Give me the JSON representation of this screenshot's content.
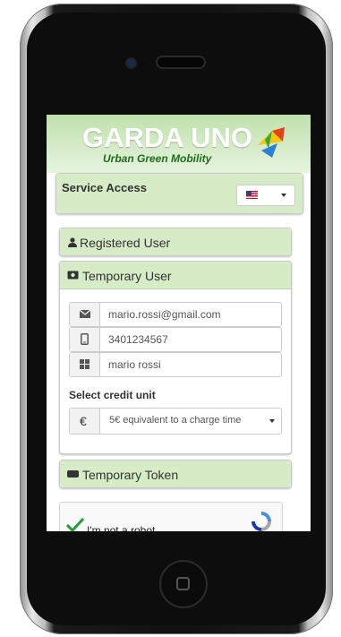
{
  "header": {
    "brand": "GARDA UNO",
    "tagline": "Urban Green Mobility"
  },
  "service": {
    "title": "Service Access",
    "language_flag": "us-flag-icon"
  },
  "sections": {
    "registered": "Registered User",
    "temporary": "Temporary User",
    "token": "Temporary Token"
  },
  "form": {
    "email": "mario.rossi@gmail.com",
    "phone": "3401234567",
    "name": "mario rossi",
    "credit_label": "Select credit unit",
    "credit_value": "5€ equivalent to a charge time",
    "currency_symbol": "€"
  },
  "captcha": {
    "label": "I'm not a robot"
  },
  "colors": {
    "panel_green": "#d6ecc7",
    "brand_green": "#1f6b1f"
  }
}
